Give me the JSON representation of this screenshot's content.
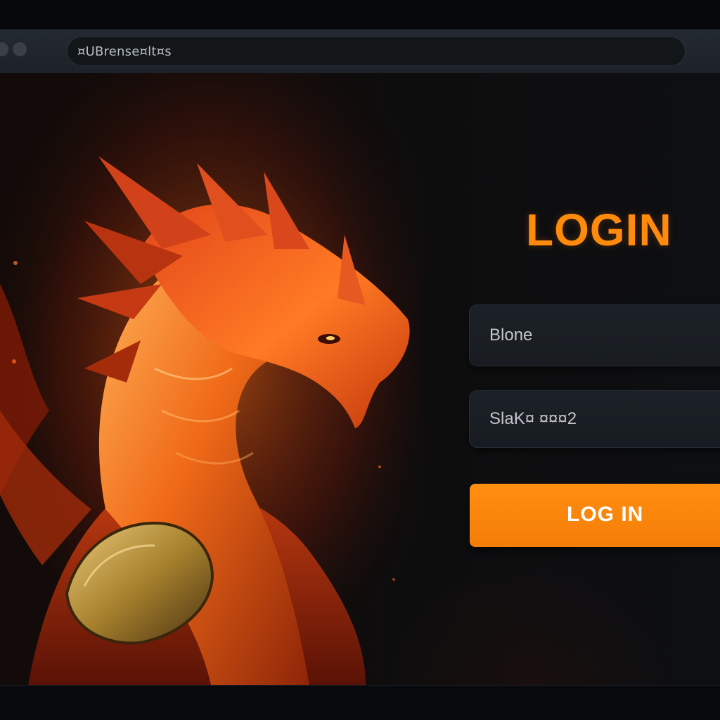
{
  "browser": {
    "address_text": "¤UBrense¤lt¤s"
  },
  "login_form": {
    "title": "LOGIN",
    "username_placeholder": "Blone",
    "password_placeholder": "SlaK¤ ¤¤¤2",
    "submit_label": "LOG IN"
  },
  "artwork": {
    "subject": "dragon-illustration"
  },
  "colors": {
    "accent": "#ff8a0c",
    "button": "#f7820a",
    "background": "#0c0e11",
    "field_bg": "#1b2026",
    "chrome": "#22272d"
  }
}
